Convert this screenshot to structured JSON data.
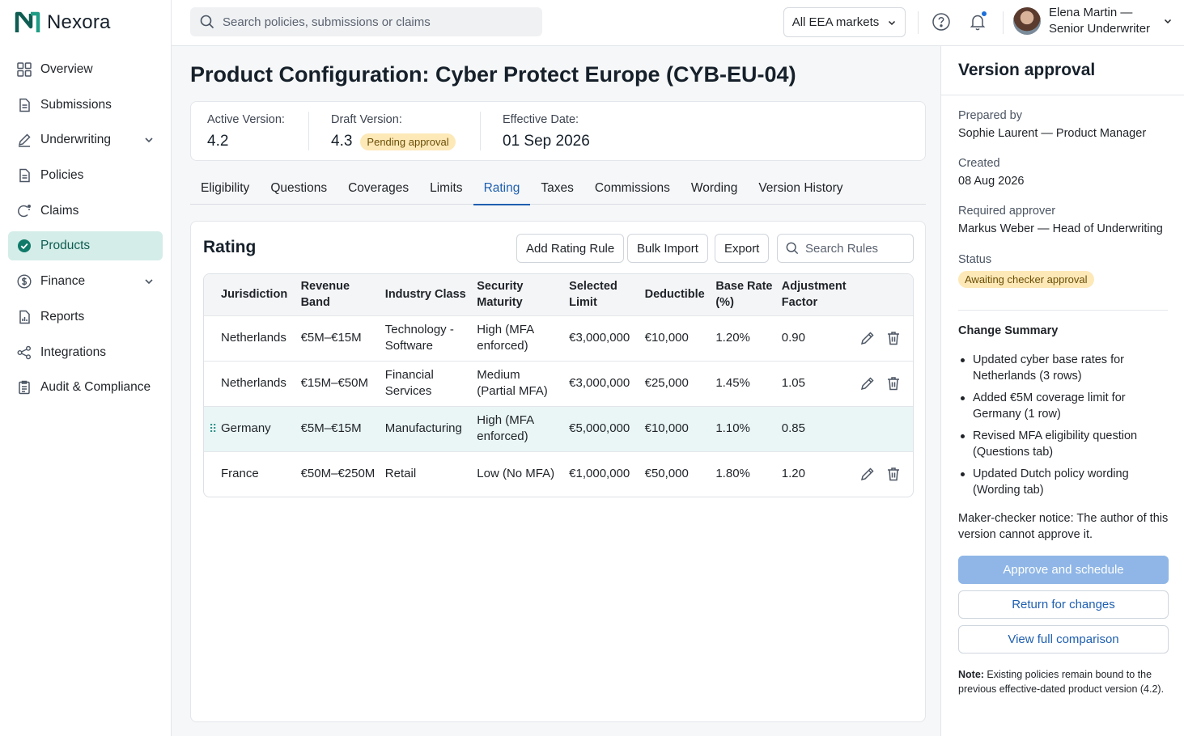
{
  "brand": {
    "name": "Nexora"
  },
  "nav": [
    {
      "label": "Overview",
      "icon": "grid-icon"
    },
    {
      "label": "Submissions",
      "icon": "document-icon"
    },
    {
      "label": "Underwriting",
      "icon": "pen-icon",
      "expandable": true
    },
    {
      "label": "Policies",
      "icon": "document-icon"
    },
    {
      "label": "Claims",
      "icon": "claims-icon"
    },
    {
      "label": "Products",
      "icon": "check-badge-icon",
      "active": true
    },
    {
      "label": "Finance",
      "icon": "dollar-circle-icon",
      "expandable": true
    },
    {
      "label": "Reports",
      "icon": "report-icon"
    },
    {
      "label": "Integrations",
      "icon": "share-nodes-icon"
    },
    {
      "label": "Audit & Compliance",
      "icon": "clipboard-icon"
    }
  ],
  "topbar": {
    "search_placeholder": "Search policies, submissions or claims",
    "market": "All EEA markets",
    "user_name": "Elena Martin —",
    "user_role": "Senior Underwriter"
  },
  "page": {
    "title_bold": "Product Configuration:",
    "title_rest": "Cyber Protect Europe (CYB-EU-04)"
  },
  "summary": {
    "active_label": "Active Version:",
    "active_value": "4.2",
    "draft_label": "Draft Version:",
    "draft_value": "4.3",
    "draft_badge": "Pending approval",
    "effective_label": "Effective Date:",
    "effective_value": "01 Sep 2026"
  },
  "tabs": [
    "Eligibility",
    "Questions",
    "Coverages",
    "Limits",
    "Rating",
    "Taxes",
    "Commissions",
    "Wording",
    "Version History"
  ],
  "active_tab": "Rating",
  "rating": {
    "title": "Rating",
    "add_label": "Add Rating Rule",
    "import_label": "Bulk Import",
    "export_label": "Export",
    "search_placeholder": "Search Rules",
    "columns": {
      "jurisdiction": "Jurisdiction",
      "revenue_1": "Revenue",
      "revenue_2": "Band",
      "industry": "Industry Class",
      "security_1": "Security",
      "security_2": "Maturity",
      "limit_1": "Selected",
      "limit_2": "Limit",
      "deductible": "Deductible",
      "rate_1": "Base Rate",
      "rate_2": "(%)",
      "adj_1": "Adjustment",
      "adj_2": "Factor"
    },
    "rows": [
      {
        "jurisdiction": "Netherlands",
        "revenue": "€5M–€15M",
        "industry_1": "Technology -",
        "industry_2": "Software",
        "security_1": "High (MFA",
        "security_2": "enforced)",
        "limit": "€3,000,000",
        "deductible": "€10,000",
        "rate": "1.20%",
        "factor": "0.90"
      },
      {
        "jurisdiction": "Netherlands",
        "revenue": "€15M–€50M",
        "industry_1": "Financial",
        "industry_2": "Services",
        "security_1": "Medium",
        "security_2": "(Partial MFA)",
        "limit": "€3,000,000",
        "deductible": "€25,000",
        "rate": "1.45%",
        "factor": "1.05"
      },
      {
        "jurisdiction": "Germany",
        "revenue": "€5M–€15M",
        "industry_1": "Manufacturing",
        "industry_2": "",
        "security_1": "High (MFA",
        "security_2": "enforced)",
        "limit": "€5,000,000",
        "deductible": "€10,000",
        "rate": "1.10%",
        "factor": "0.85"
      },
      {
        "jurisdiction": "France",
        "revenue": "€50M–€250M",
        "industry_1": "Retail",
        "industry_2": "",
        "security_1": "Low (No MFA)",
        "security_2": "",
        "limit": "€1,000,000",
        "deductible": "€50,000",
        "rate": "1.80%",
        "factor": "1.20"
      }
    ]
  },
  "approval": {
    "title": "Version approval",
    "prepared_label": "Prepared by",
    "prepared_value": "Sophie Laurent — Product Manager",
    "created_label": "Created",
    "created_value": "08 Aug 2026",
    "approver_label": "Required approver",
    "approver_value": "Markus Weber — Head of Underwriting",
    "status_label": "Status",
    "status_value": "Awaiting checker approval",
    "change_title": "Change Summary",
    "changes": [
      "Updated cyber base rates for Netherlands (3 rows)",
      "Added €5M coverage limit for Germany (1 row)",
      "Revised MFA eligibility question (Questions tab)",
      "Updated Dutch policy wording (Wording tab)"
    ],
    "notice": "Maker-checker notice: The author of this version cannot approve it.",
    "approve_label": "Approve and schedule",
    "return_label": "Return for changes",
    "compare_label": "View full comparison",
    "note_bold": "Note:",
    "note_text": " Existing policies remain bound to the previous effective-dated product version (4.2)."
  },
  "colors": {
    "accent": "#1e5fb0",
    "brand": "#0f7a6a",
    "active_nav_bg": "#d4ede8",
    "badge_bg": "#fde9b8",
    "row_highlight": "#eaf6f6"
  }
}
